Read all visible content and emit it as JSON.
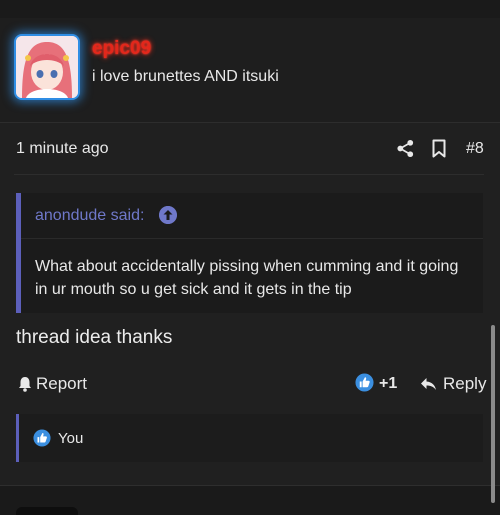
{
  "post": {
    "username": "epic09",
    "user_title": "i love brunettes AND itsuki",
    "date": "1 minute ago",
    "post_number": "#8",
    "body": "thread idea thanks"
  },
  "quote": {
    "author_label": "anondude said:",
    "text": "What about accidentally pissing when cumming and it going in ur mouth so u get sick and it gets in the tip"
  },
  "actions": {
    "report_label": "Report",
    "like_count": "+1",
    "reply_label": "Reply"
  },
  "reactions": {
    "summary": "You"
  },
  "icons": {
    "share": "share-icon",
    "bookmark": "bookmark-icon",
    "quote_jump": "arrow-up-circle-icon",
    "report": "bell-icon",
    "like": "thumbs-up-icon",
    "reply": "reply-arrow-icon"
  },
  "colors": {
    "username": "#e3271b",
    "accent": "#5c5fba",
    "avatar_glow": "#2f8de4",
    "like_blue": "#3b8fe0"
  }
}
